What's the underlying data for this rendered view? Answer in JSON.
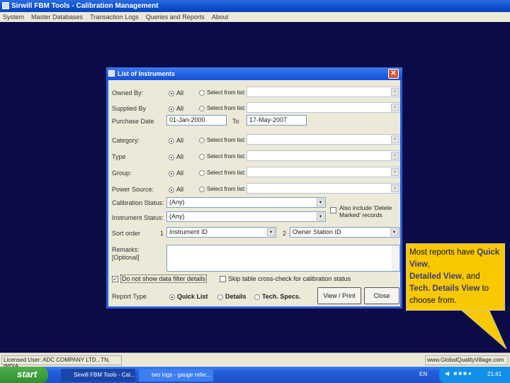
{
  "window": {
    "title": "Sirwill FBM Tools - Calibration Management"
  },
  "menu": [
    "System",
    "Master Databases",
    "Transaction Logs",
    "Queries and Reports",
    "About"
  ],
  "dialog": {
    "title": "List of Instruments",
    "all_label": "All",
    "select_label": "Select from list:",
    "filters": [
      {
        "label": "Owned By:"
      },
      {
        "label": "Supplied By"
      },
      {
        "label": "Category:"
      },
      {
        "label": "Type"
      },
      {
        "label": "Group:"
      },
      {
        "label": "Power Source:"
      }
    ],
    "purchase_date": {
      "label": "Purchase Date",
      "from": "01-Jan-2000",
      "to_label": "To",
      "to": "17-May-2007"
    },
    "calibration_status": {
      "label": "Calibration Status:",
      "value": "(Any)"
    },
    "instrument_status": {
      "label": "Instrument Status:",
      "value": "(Any)"
    },
    "include_deleted": "Also include 'Delete Marked' records",
    "sort": {
      "label": "Sort order",
      "n1": "1",
      "v1": "Instrument ID",
      "n2": "2",
      "v2": "Owner Station ID"
    },
    "remarks_label": "Remarks: [Optional]",
    "dont_show": "Do not show data filter details",
    "skip_check": "Skip table cross-check for calibration status",
    "report_type": {
      "label": "Report Type",
      "options": [
        "Quick List",
        "Details",
        "Tech. Specs."
      ],
      "selected": "Quick List"
    },
    "view_print": "View / Print",
    "close": "Close"
  },
  "callout": {
    "t1": "Most reports have ",
    "b1": "Quick View",
    ",": ",",
    "b2": "Detailed View",
    "t2": ", and ",
    "b3": "Tech. Details View",
    "t3": " to choose from."
  },
  "status": {
    "licensed": "Licensed User: ADC COMPANY LTD., TN, INDIA",
    "website": "www.GlobalQualityVillage.com"
  },
  "taskbar": {
    "start": "start",
    "tasks": [
      "Sirwill FBM Tools - Cal...",
      "two logs - gauge refer..."
    ],
    "lang": "EN",
    "clock": "21:41"
  }
}
